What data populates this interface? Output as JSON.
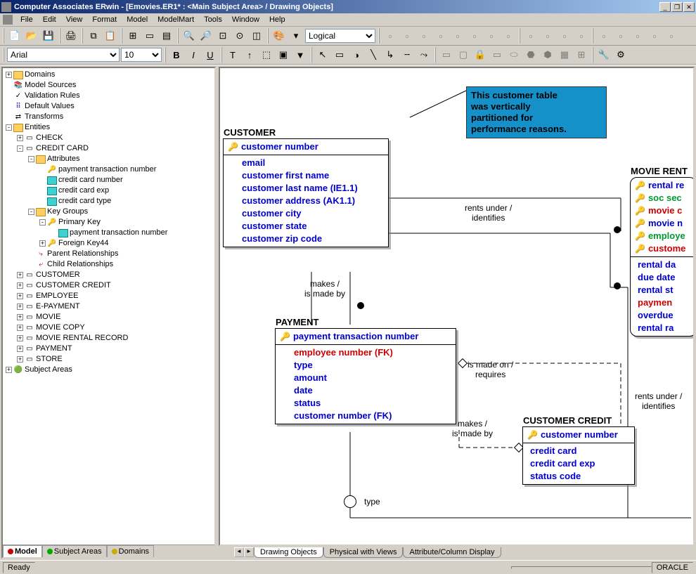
{
  "title": "Computer Associates ERwin - [Emovies.ER1* : <Main Subject Area> / Drawing Objects]",
  "menus": [
    "File",
    "Edit",
    "View",
    "Format",
    "Model",
    "ModelMart",
    "Tools",
    "Window",
    "Help"
  ],
  "toolbar1": {
    "view_selector": "Logical"
  },
  "toolbar2": {
    "font": "Arial",
    "size": "10"
  },
  "tree": {
    "domains": "Domains",
    "model_sources": "Model Sources",
    "validation_rules": "Validation Rules",
    "default_values": "Default Values",
    "transforms": "Transforms",
    "entities": "Entities",
    "check": "CHECK",
    "credit_card": "CREDIT CARD",
    "attributes": "Attributes",
    "ptn": "payment transaction number",
    "ccn": "credit card number",
    "cce": "credit card exp",
    "cct": "credit card type",
    "key_groups": "Key Groups",
    "primary_key": "Primary Key",
    "fk44": "Foreign Key44",
    "parent_rel": "Parent Relationships",
    "child_rel": "Child Relationships",
    "customer": "CUSTOMER",
    "customer_credit": "CUSTOMER CREDIT",
    "employee": "EMPLOYEE",
    "epayment": "E-PAYMENT",
    "movie": "MOVIE",
    "movie_copy": "MOVIE COPY",
    "movie_rental": "MOVIE RENTAL RECORD",
    "payment": "PAYMENT",
    "store": "STORE",
    "subject_areas": "Subject Areas"
  },
  "side_tabs": {
    "model": "Model",
    "subject_areas": "Subject Areas",
    "domains": "Domains"
  },
  "canvas_tabs": {
    "t1": "Drawing Objects",
    "t2": "Physical with Views",
    "t3": "Attribute/Column Display"
  },
  "status": {
    "ready": "Ready",
    "db": "ORACLE"
  },
  "note": {
    "l1": "This customer table",
    "l2": "was vertically",
    "l3": "partitioned for",
    "l4": "performance reasons."
  },
  "ent_customer": {
    "title": "CUSTOMER",
    "pk": "customer number",
    "a1": "email",
    "a2": "customer first name",
    "a3": "customer last name (IE1.1)",
    "a4": "customer address (AK1.1)",
    "a5": "customer city",
    "a6": "customer state",
    "a7": "customer zip code"
  },
  "ent_payment": {
    "title": "PAYMENT",
    "pk": "payment transaction number",
    "a1": "employee number (FK)",
    "a2": "type",
    "a3": "amount",
    "a4": "date",
    "a5": "status",
    "a6": "customer number (FK)"
  },
  "ent_cc": {
    "title": "CUSTOMER CREDIT",
    "pk": "customer number",
    "a1": "credit card",
    "a2": "credit card exp",
    "a3": "status code"
  },
  "ent_mr": {
    "title": "MOVIE RENT",
    "k1": "rental re",
    "k2": "soc sec",
    "k3": "movie c",
    "k4": "movie n",
    "k5": "employe",
    "k6": "custome",
    "a1": "rental da",
    "a2": "due date",
    "a3": "rental st",
    "a4": "paymen",
    "a5": "overdue",
    "a6": "rental ra"
  },
  "rel": {
    "makes": "makes /",
    "is_made_by": "is made by",
    "rents_under": "rents under /",
    "identifies": "identifies",
    "is_made_on": "is made on /",
    "requires": "requires",
    "type": "type"
  }
}
